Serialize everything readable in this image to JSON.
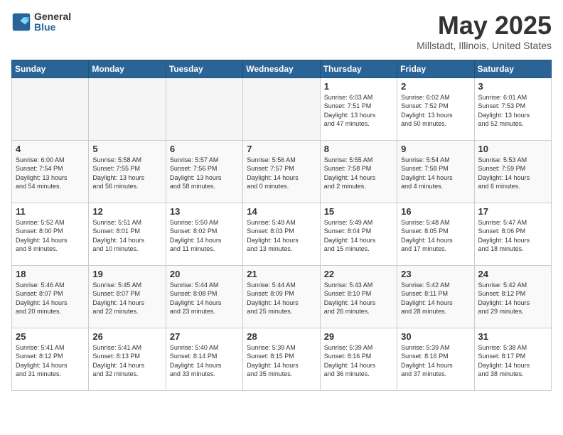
{
  "logo": {
    "general": "General",
    "blue": "Blue"
  },
  "title": "May 2025",
  "subtitle": "Millstadt, Illinois, United States",
  "days_of_week": [
    "Sunday",
    "Monday",
    "Tuesday",
    "Wednesday",
    "Thursday",
    "Friday",
    "Saturday"
  ],
  "weeks": [
    [
      {
        "num": "",
        "info": ""
      },
      {
        "num": "",
        "info": ""
      },
      {
        "num": "",
        "info": ""
      },
      {
        "num": "",
        "info": ""
      },
      {
        "num": "1",
        "info": "Sunrise: 6:03 AM\nSunset: 7:51 PM\nDaylight: 13 hours\nand 47 minutes."
      },
      {
        "num": "2",
        "info": "Sunrise: 6:02 AM\nSunset: 7:52 PM\nDaylight: 13 hours\nand 50 minutes."
      },
      {
        "num": "3",
        "info": "Sunrise: 6:01 AM\nSunset: 7:53 PM\nDaylight: 13 hours\nand 52 minutes."
      }
    ],
    [
      {
        "num": "4",
        "info": "Sunrise: 6:00 AM\nSunset: 7:54 PM\nDaylight: 13 hours\nand 54 minutes."
      },
      {
        "num": "5",
        "info": "Sunrise: 5:58 AM\nSunset: 7:55 PM\nDaylight: 13 hours\nand 56 minutes."
      },
      {
        "num": "6",
        "info": "Sunrise: 5:57 AM\nSunset: 7:56 PM\nDaylight: 13 hours\nand 58 minutes."
      },
      {
        "num": "7",
        "info": "Sunrise: 5:56 AM\nSunset: 7:57 PM\nDaylight: 14 hours\nand 0 minutes."
      },
      {
        "num": "8",
        "info": "Sunrise: 5:55 AM\nSunset: 7:58 PM\nDaylight: 14 hours\nand 2 minutes."
      },
      {
        "num": "9",
        "info": "Sunrise: 5:54 AM\nSunset: 7:58 PM\nDaylight: 14 hours\nand 4 minutes."
      },
      {
        "num": "10",
        "info": "Sunrise: 5:53 AM\nSunset: 7:59 PM\nDaylight: 14 hours\nand 6 minutes."
      }
    ],
    [
      {
        "num": "11",
        "info": "Sunrise: 5:52 AM\nSunset: 8:00 PM\nDaylight: 14 hours\nand 8 minutes."
      },
      {
        "num": "12",
        "info": "Sunrise: 5:51 AM\nSunset: 8:01 PM\nDaylight: 14 hours\nand 10 minutes."
      },
      {
        "num": "13",
        "info": "Sunrise: 5:50 AM\nSunset: 8:02 PM\nDaylight: 14 hours\nand 11 minutes."
      },
      {
        "num": "14",
        "info": "Sunrise: 5:49 AM\nSunset: 8:03 PM\nDaylight: 14 hours\nand 13 minutes."
      },
      {
        "num": "15",
        "info": "Sunrise: 5:49 AM\nSunset: 8:04 PM\nDaylight: 14 hours\nand 15 minutes."
      },
      {
        "num": "16",
        "info": "Sunrise: 5:48 AM\nSunset: 8:05 PM\nDaylight: 14 hours\nand 17 minutes."
      },
      {
        "num": "17",
        "info": "Sunrise: 5:47 AM\nSunset: 8:06 PM\nDaylight: 14 hours\nand 18 minutes."
      }
    ],
    [
      {
        "num": "18",
        "info": "Sunrise: 5:46 AM\nSunset: 8:07 PM\nDaylight: 14 hours\nand 20 minutes."
      },
      {
        "num": "19",
        "info": "Sunrise: 5:45 AM\nSunset: 8:07 PM\nDaylight: 14 hours\nand 22 minutes."
      },
      {
        "num": "20",
        "info": "Sunrise: 5:44 AM\nSunset: 8:08 PM\nDaylight: 14 hours\nand 23 minutes."
      },
      {
        "num": "21",
        "info": "Sunrise: 5:44 AM\nSunset: 8:09 PM\nDaylight: 14 hours\nand 25 minutes."
      },
      {
        "num": "22",
        "info": "Sunrise: 5:43 AM\nSunset: 8:10 PM\nDaylight: 14 hours\nand 26 minutes."
      },
      {
        "num": "23",
        "info": "Sunrise: 5:42 AM\nSunset: 8:11 PM\nDaylight: 14 hours\nand 28 minutes."
      },
      {
        "num": "24",
        "info": "Sunrise: 5:42 AM\nSunset: 8:12 PM\nDaylight: 14 hours\nand 29 minutes."
      }
    ],
    [
      {
        "num": "25",
        "info": "Sunrise: 5:41 AM\nSunset: 8:12 PM\nDaylight: 14 hours\nand 31 minutes."
      },
      {
        "num": "26",
        "info": "Sunrise: 5:41 AM\nSunset: 8:13 PM\nDaylight: 14 hours\nand 32 minutes."
      },
      {
        "num": "27",
        "info": "Sunrise: 5:40 AM\nSunset: 8:14 PM\nDaylight: 14 hours\nand 33 minutes."
      },
      {
        "num": "28",
        "info": "Sunrise: 5:39 AM\nSunset: 8:15 PM\nDaylight: 14 hours\nand 35 minutes."
      },
      {
        "num": "29",
        "info": "Sunrise: 5:39 AM\nSunset: 8:16 PM\nDaylight: 14 hours\nand 36 minutes."
      },
      {
        "num": "30",
        "info": "Sunrise: 5:39 AM\nSunset: 8:16 PM\nDaylight: 14 hours\nand 37 minutes."
      },
      {
        "num": "31",
        "info": "Sunrise: 5:38 AM\nSunset: 8:17 PM\nDaylight: 14 hours\nand 38 minutes."
      }
    ]
  ]
}
